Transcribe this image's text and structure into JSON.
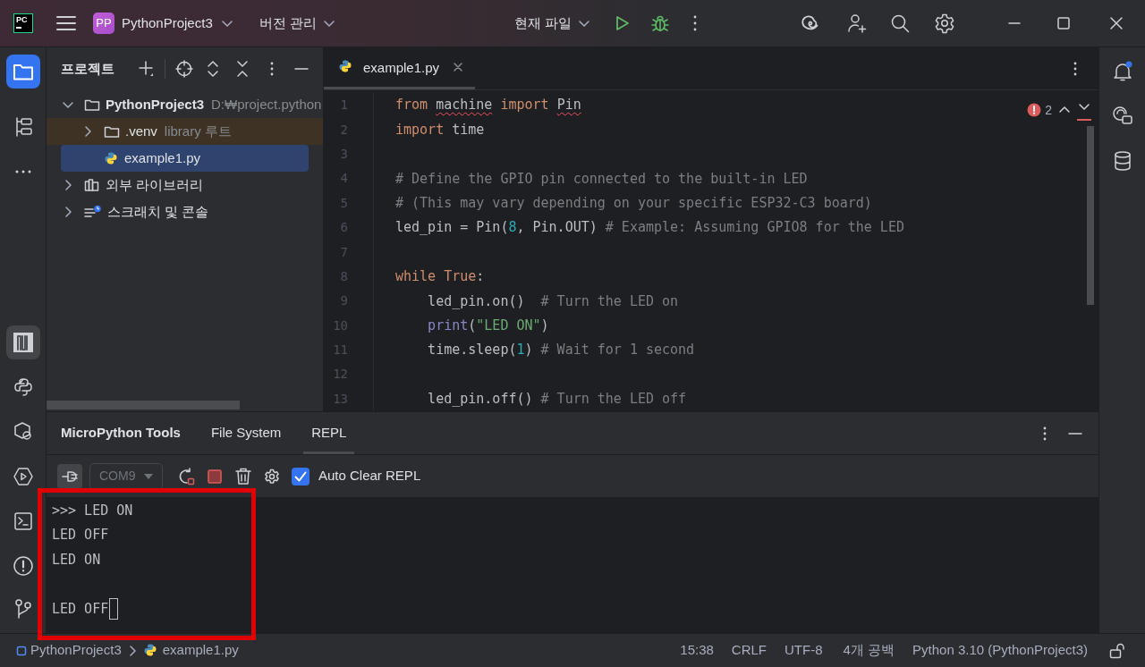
{
  "title_bar": {
    "app_logo": "PC",
    "project_badge": "PP",
    "project": "PythonProject3",
    "vcs": "버전 관리",
    "run_config": "현재 파일"
  },
  "project_panel": {
    "title": "프로젝트",
    "tree": [
      {
        "label": "PythonProject3",
        "hint": "D:₩project.python",
        "kind": "folder",
        "expanded": true,
        "selected": false,
        "children": [
          {
            "label": ".venv",
            "hint": "library 루트",
            "kind": "folder",
            "expanded": false,
            "selected": false,
            "highlighted": true
          },
          {
            "label": "example1.py",
            "kind": "file",
            "selected": true
          }
        ]
      },
      {
        "label": "외부 라이브러리",
        "kind": "library",
        "expanded": false,
        "selected": false
      },
      {
        "label": "스크래치 및 콘솔",
        "kind": "scratch",
        "expanded": false,
        "selected": false
      }
    ]
  },
  "editor": {
    "tabs": [
      {
        "label": "example1.py",
        "selected": true
      }
    ],
    "problems": "2",
    "lines": [
      {
        "number": "1",
        "tokens": [
          {
            "t": "from ",
            "kind": "keyword"
          },
          {
            "t": "machine",
            "kind": "plain",
            "squiggle": true
          },
          {
            "t": " import ",
            "kind": "keyword"
          },
          {
            "t": "Pin",
            "kind": "plain",
            "squiggle": true
          }
        ]
      },
      {
        "number": "2",
        "tokens": [
          {
            "t": "import ",
            "kind": "keyword"
          },
          {
            "t": "time",
            "kind": "plain"
          }
        ]
      },
      {
        "number": "3"
      },
      {
        "number": "4",
        "tokens": [
          {
            "t": "# Define the GPIO pin connected to the built-in LED",
            "kind": "comment"
          }
        ]
      },
      {
        "number": "5",
        "tokens": [
          {
            "t": "# (This may vary depending on your specific ESP32-C3 board)",
            "kind": "comment"
          }
        ]
      },
      {
        "number": "6",
        "tokens": [
          {
            "t": "led_pin = Pin(",
            "kind": "plain"
          },
          {
            "t": "8",
            "kind": "number"
          },
          {
            "t": ", Pin.OUT) ",
            "kind": "plain"
          },
          {
            "t": "# Example: Assuming GPIO8 for the LED",
            "kind": "comment"
          }
        ]
      },
      {
        "number": "7"
      },
      {
        "number": "8",
        "tokens": [
          {
            "t": "while ",
            "kind": "keyword"
          },
          {
            "t": "True",
            "kind": "keyword"
          },
          {
            "t": ":",
            "kind": "plain"
          }
        ]
      },
      {
        "number": "9",
        "tokens": [
          {
            "t": "    led_pin.on()  ",
            "kind": "plain"
          },
          {
            "t": "# Turn the LED on",
            "kind": "comment"
          }
        ]
      },
      {
        "number": "10",
        "tokens": [
          {
            "t": "    print",
            "kind": "builtin"
          },
          {
            "t": "(",
            "kind": "plain"
          },
          {
            "t": "\"LED ON\"",
            "kind": "string"
          },
          {
            "t": ")",
            "kind": "plain"
          }
        ]
      },
      {
        "number": "11",
        "tokens": [
          {
            "t": "    time.sleep(",
            "kind": "plain"
          },
          {
            "t": "1",
            "kind": "number"
          },
          {
            "t": ") ",
            "kind": "plain"
          },
          {
            "t": "# Wait for 1 second",
            "kind": "comment"
          }
        ]
      },
      {
        "number": "12"
      },
      {
        "number": "13",
        "tokens": [
          {
            "t": "    led_pin.off() ",
            "kind": "plain"
          },
          {
            "t": "# Turn the LED off",
            "kind": "comment"
          }
        ]
      }
    ]
  },
  "tool_window": {
    "title": "MicroPython Tools",
    "tabs": [
      {
        "label": "File System",
        "selected": false
      },
      {
        "label": "REPL",
        "selected": true
      }
    ],
    "port": "COM9",
    "auto_clear": {
      "label": "Auto Clear REPL",
      "checked": true
    },
    "console": [
      {
        "text": ">>> LED ON"
      },
      {
        "text": "LED OFF"
      },
      {
        "text": "LED ON"
      },
      {
        "text": "LED OFF",
        "blank_line_before": true,
        "cursor": true
      }
    ]
  },
  "status_bar": {
    "breadcrumbs": [
      {
        "label": "PythonProject3",
        "kind": "project"
      },
      {
        "label": "example1.py",
        "kind": "python"
      }
    ],
    "items": [
      "15:38",
      "CRLF",
      "UTF-8",
      "4개 공백",
      "Python 3.10 (PythonProject3)"
    ]
  }
}
